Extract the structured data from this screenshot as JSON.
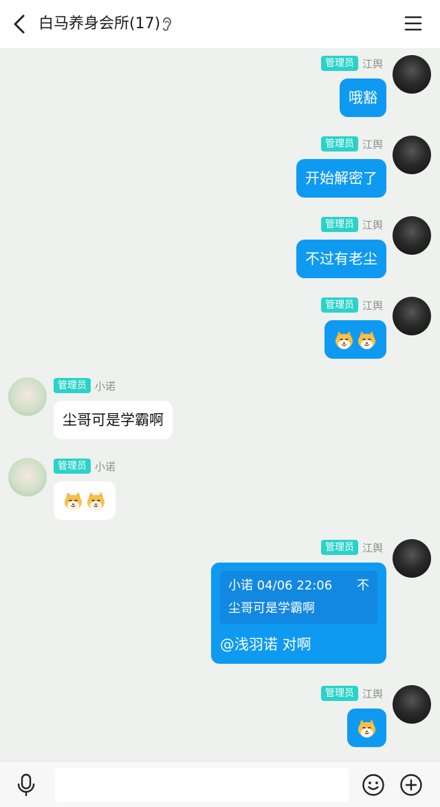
{
  "header": {
    "title": "白马养身会所(17)"
  },
  "roles": {
    "admin": "管理员"
  },
  "messages": [
    {
      "sender": "江舆",
      "text": "哦豁"
    },
    {
      "sender": "江舆",
      "text": "开始解密了"
    },
    {
      "sender": "江舆",
      "text": "不过有老尘"
    },
    {
      "sender": "江舆",
      "emoji": [
        "cat-face-emoji",
        "cat-face-emoji"
      ]
    },
    {
      "sender": "小诺",
      "text": "尘哥可是学霸啊"
    },
    {
      "sender": "小诺",
      "emoji": [
        "cat-face-emoji",
        "cat-face-emoji"
      ]
    },
    {
      "sender": "江舆",
      "quote": {
        "author_time": "小诺 04/06 22:06",
        "flag": "不",
        "text": "尘哥可是学霸啊"
      },
      "text": "@浅羽诺 对啊"
    },
    {
      "sender": "江舆",
      "emoji": [
        "cat-face-emoji"
      ]
    }
  ],
  "colors": {
    "outgoing_bubble": "#0f9af2",
    "incoming_bubble": "#ffffff",
    "admin_badge": "#2ad2c9",
    "chat_background": "#eef1ee"
  }
}
